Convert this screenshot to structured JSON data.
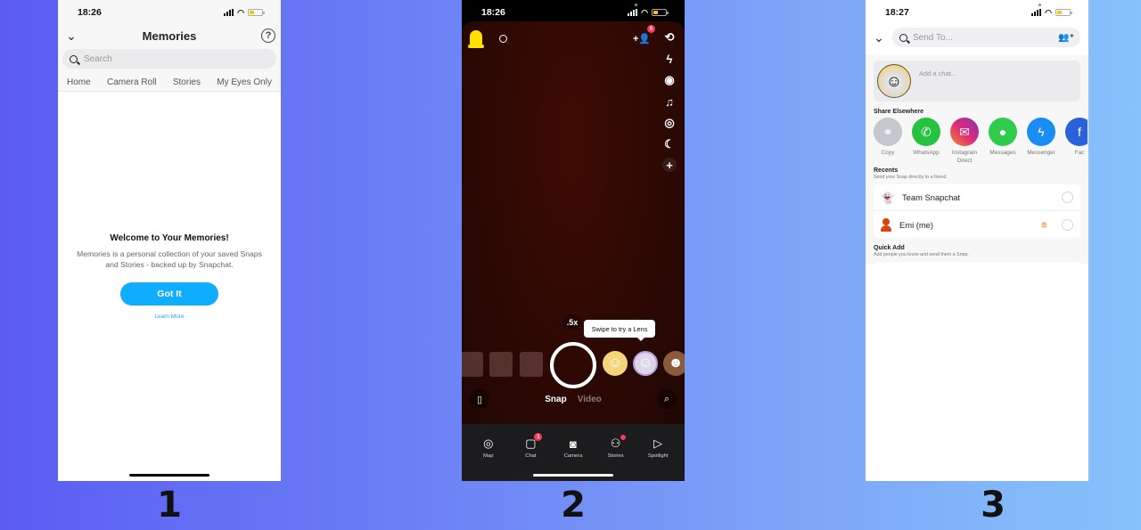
{
  "steps": [
    "1",
    "2",
    "3"
  ],
  "phone1": {
    "status": {
      "time": "18:26"
    },
    "header": {
      "title": "Memories",
      "back_icon": "chevron-down-icon",
      "help_icon": "help-circle-icon"
    },
    "search": {
      "placeholder": "Search"
    },
    "tabs": [
      {
        "label": "Home"
      },
      {
        "label": "Camera Roll"
      },
      {
        "label": "Stories"
      },
      {
        "label": "My Eyes Only"
      }
    ],
    "welcome": {
      "title": "Welcome to Your Memories!",
      "body": "Memories is a personal collection of your saved Snaps and Stories - backed up by Snapchat.",
      "button": "Got It",
      "link": "Learn More"
    },
    "colors": {
      "accent": "#10adff"
    }
  },
  "phone2": {
    "status": {
      "time": "18:26"
    },
    "top": {
      "add_friend_badge": "5"
    },
    "side_tools": [
      {
        "icon": "flip-camera-icon",
        "glyph": "⟲"
      },
      {
        "icon": "flash-off-icon",
        "glyph": "ϟ"
      },
      {
        "icon": "video-chat-icon",
        "glyph": "◉"
      },
      {
        "icon": "music-icon",
        "glyph": "♫"
      },
      {
        "icon": "lens-camera-icon",
        "glyph": "◎"
      },
      {
        "icon": "night-mode-icon",
        "glyph": "☾"
      },
      {
        "icon": "plus-icon",
        "glyph": "+"
      }
    ],
    "zoom_level": ".5x",
    "tooltip": "Swipe to try a Lens",
    "modes": {
      "active": "Snap",
      "inactive": "Video"
    },
    "nav": [
      {
        "label": "Map",
        "icon": "map-pin-icon",
        "glyph": "◎"
      },
      {
        "label": "Chat",
        "icon": "chat-icon",
        "glyph": "▢",
        "badge": "1"
      },
      {
        "label": "Camera",
        "icon": "camera-icon",
        "glyph": "◙"
      },
      {
        "label": "Stories",
        "icon": "stories-icon",
        "glyph": "⚇",
        "dot": true
      },
      {
        "label": "Spotlight",
        "icon": "spotlight-play-icon",
        "glyph": "▷"
      }
    ],
    "colors": {
      "badge": "#f23c57",
      "ghost": "#ffe100"
    }
  },
  "phone3": {
    "status": {
      "time": "18:27"
    },
    "search": {
      "placeholder": "Send To..."
    },
    "chat": {
      "placeholder": "Add a chat..."
    },
    "share": {
      "title": "Share Elsewhere",
      "items": [
        {
          "label": "Copy",
          "icon": "link-icon",
          "color": "#c4c7cc",
          "glyph": "🔗"
        },
        {
          "label": "WhatsApp",
          "icon": "whatsapp-icon",
          "color": "#25c23f",
          "glyph": "✆"
        },
        {
          "label": "Instagram Direct",
          "icon": "instagram-direct-icon",
          "color": "#c52f9a",
          "glyph": "✉"
        },
        {
          "label": "Messages",
          "icon": "messages-icon",
          "color": "#2fcb4b",
          "glyph": "●"
        },
        {
          "label": "Messenger",
          "icon": "messenger-icon",
          "color": "#1a8cf5",
          "glyph": "ϟ"
        },
        {
          "label": "Fac",
          "icon": "facebook-icon",
          "color": "#2b62d9",
          "glyph": "f"
        }
      ]
    },
    "recents": {
      "title": "Recents",
      "subtitle": "Send your Snap directly to a friend.",
      "items": [
        {
          "name": "Team Snapchat"
        },
        {
          "name": "Emi (me)",
          "emoji": "🎂"
        }
      ]
    },
    "quick_add": {
      "title": "Quick Add",
      "subtitle": "Add people you know and send them a Snap."
    }
  }
}
